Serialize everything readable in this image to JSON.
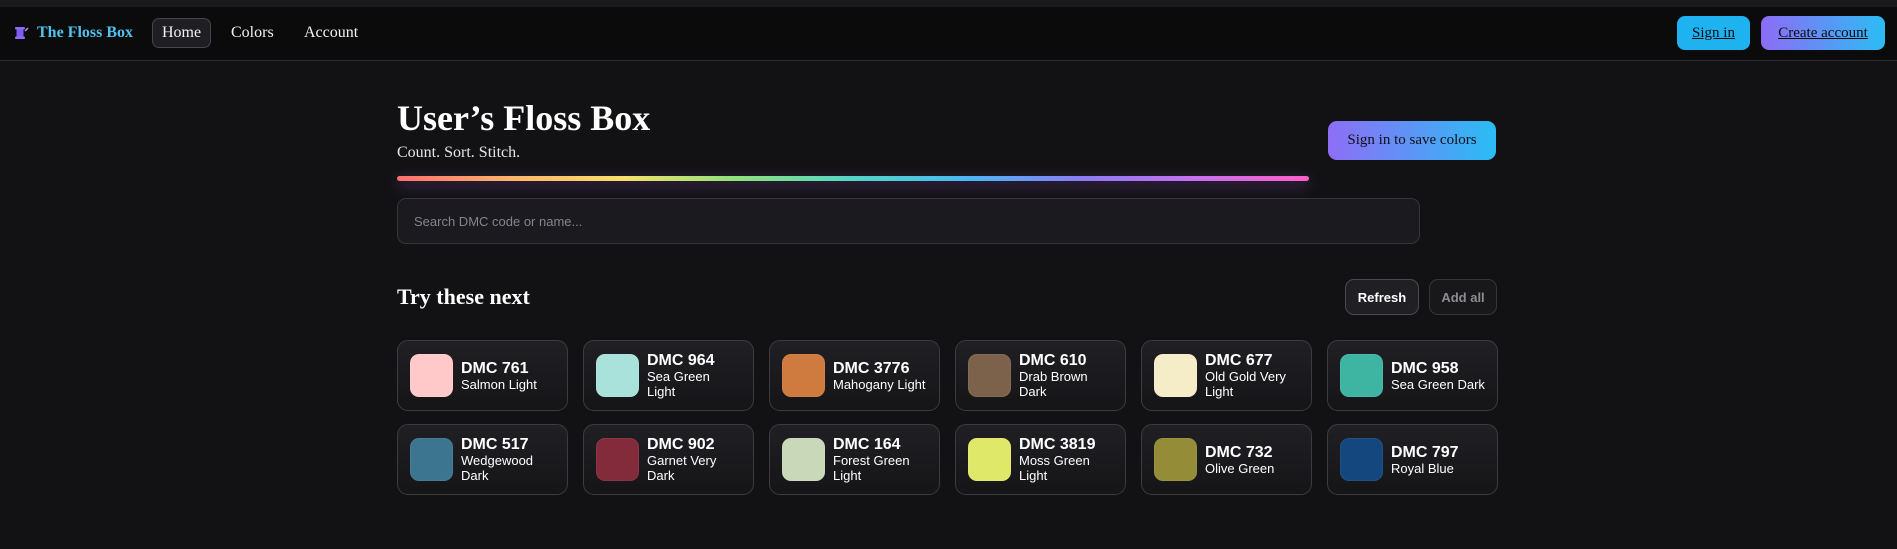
{
  "nav": {
    "brand": "The Floss Box",
    "links": [
      "Home",
      "Colors",
      "Account"
    ],
    "sign_in": "Sign in",
    "create_account": "Create account"
  },
  "header": {
    "title": "User’s Floss Box",
    "subtitle": "Count. Sort. Stitch.",
    "save_button": "Sign in to save colors"
  },
  "search": {
    "placeholder": "Search DMC code or name...",
    "value": ""
  },
  "suggestions": {
    "title": "Try these next",
    "refresh": "Refresh",
    "add_all": "Add all",
    "items": [
      {
        "code": "DMC 761",
        "name": "Salmon Light",
        "color": "#ffc9c9"
      },
      {
        "code": "DMC 964",
        "name": "Sea Green Light",
        "color": "#a9e2da"
      },
      {
        "code": "DMC 3776",
        "name": "Mahogany Light",
        "color": "#cf7b3f"
      },
      {
        "code": "DMC 610",
        "name": "Drab Brown Dark",
        "color": "#7c624a"
      },
      {
        "code": "DMC 677",
        "name": "Old Gold Very Light",
        "color": "#f5ecc8"
      },
      {
        "code": "DMC 958",
        "name": "Sea Green Dark",
        "color": "#3eb5a3"
      },
      {
        "code": "DMC 517",
        "name": "Wedgewood Dark",
        "color": "#3c7590"
      },
      {
        "code": "DMC 902",
        "name": "Garnet Very Dark",
        "color": "#832a3b"
      },
      {
        "code": "DMC 164",
        "name": "Forest Green Light",
        "color": "#c8d8b9"
      },
      {
        "code": "DMC 3819",
        "name": "Moss Green Light",
        "color": "#e0e86a"
      },
      {
        "code": "DMC 732",
        "name": "Olive Green",
        "color": "#948c36"
      },
      {
        "code": "DMC 797",
        "name": "Royal Blue",
        "color": "#13477d"
      }
    ]
  },
  "colors": {
    "brand": "#4ec3ee",
    "sign_in_bg": "#1fb2f0",
    "accent_gradient": [
      "#8e6ef6",
      "#2bbcf5"
    ],
    "background": "#121214"
  }
}
